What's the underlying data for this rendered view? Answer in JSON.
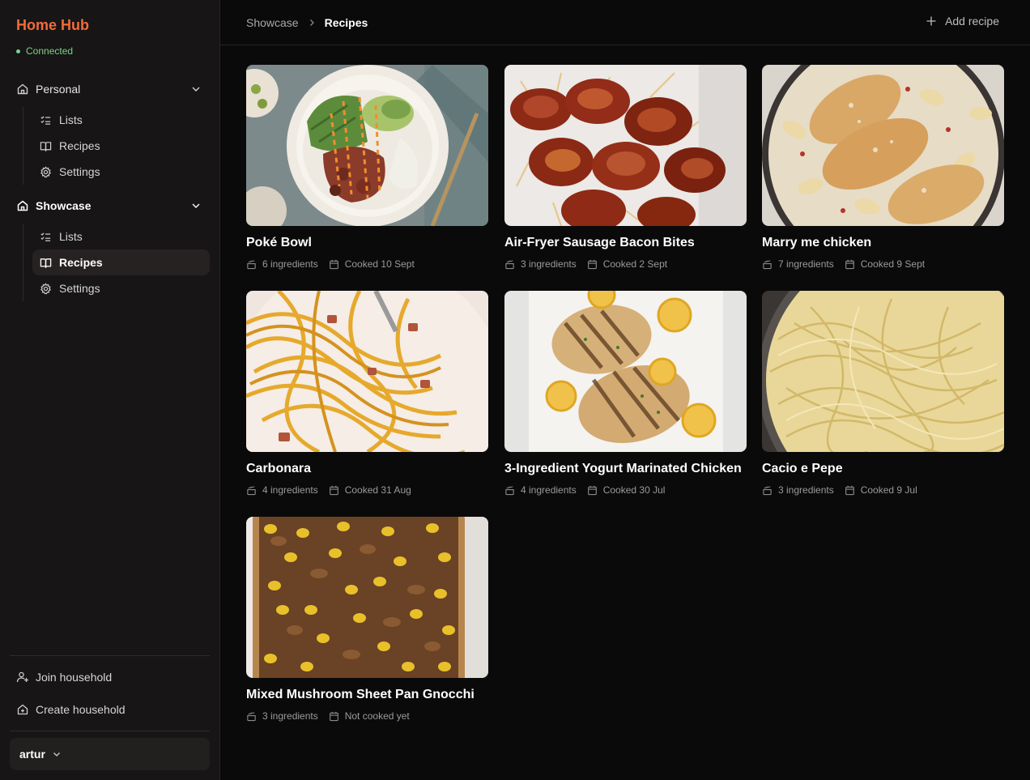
{
  "app": {
    "brand": "Home Hub",
    "status": "Connected",
    "accent": "#f26b3a",
    "status_color": "#7bd389"
  },
  "sidebar": {
    "groups": [
      {
        "label": "Personal",
        "icon": "home-icon",
        "items": [
          {
            "label": "Lists",
            "icon": "list-icon"
          },
          {
            "label": "Recipes",
            "icon": "book-icon"
          },
          {
            "label": "Settings",
            "icon": "gear-icon"
          }
        ]
      },
      {
        "label": "Showcase",
        "icon": "home-icon",
        "items": [
          {
            "label": "Lists",
            "icon": "list-icon"
          },
          {
            "label": "Recipes",
            "icon": "book-icon",
            "selected": true
          },
          {
            "label": "Settings",
            "icon": "gear-icon"
          }
        ]
      }
    ],
    "footer": {
      "join": "Join household",
      "create": "Create household",
      "user": "artur"
    }
  },
  "header": {
    "breadcrumb": [
      "Showcase",
      "Recipes"
    ],
    "add_label": "Add recipe"
  },
  "recipes": [
    {
      "title": "Poké Bowl",
      "ingredients": "6 ingredients",
      "cooked": "Cooked 10 Sept"
    },
    {
      "title": "Air-Fryer Sausage Bacon Bites",
      "ingredients": "3 ingredients",
      "cooked": "Cooked 2 Sept"
    },
    {
      "title": "Marry me chicken",
      "ingredients": "7 ingredients",
      "cooked": "Cooked 9 Sept"
    },
    {
      "title": "Carbonara",
      "ingredients": "4 ingredients",
      "cooked": "Cooked 31 Aug"
    },
    {
      "title": "3-Ingredient Yogurt Marinated Chicken",
      "ingredients": "4 ingredients",
      "cooked": "Cooked 30 Jul"
    },
    {
      "title": "Cacio e Pepe",
      "ingredients": "3 ingredients",
      "cooked": "Cooked 9 Jul"
    },
    {
      "title": "Mixed Mushroom Sheet Pan Gnocchi",
      "ingredients": "3 ingredients",
      "cooked": "Not cooked yet"
    }
  ]
}
